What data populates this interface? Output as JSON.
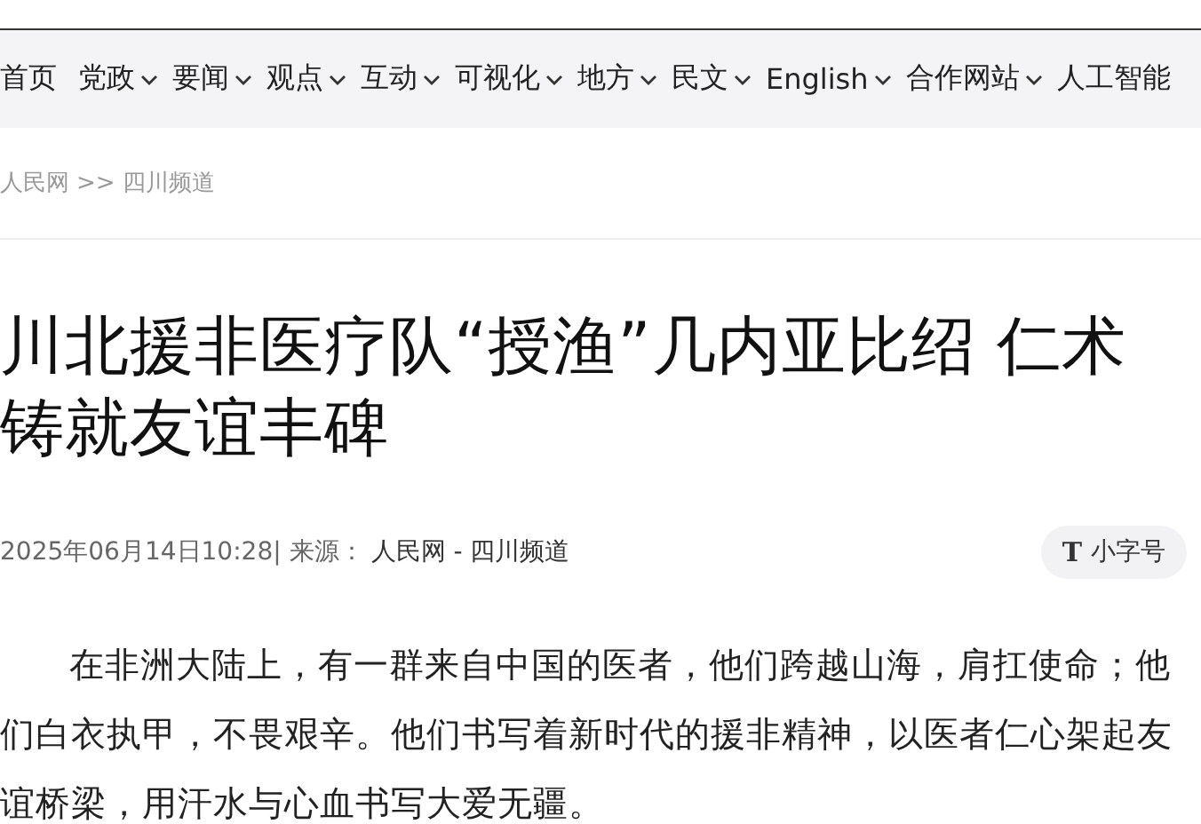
{
  "nav": {
    "items": [
      {
        "label": "首页",
        "dropdown": false
      },
      {
        "label": "党政",
        "dropdown": true
      },
      {
        "label": "要闻",
        "dropdown": true
      },
      {
        "label": "观点",
        "dropdown": true
      },
      {
        "label": "互动",
        "dropdown": true
      },
      {
        "label": "可视化",
        "dropdown": true
      },
      {
        "label": "地方",
        "dropdown": true
      },
      {
        "label": "民文",
        "dropdown": true
      },
      {
        "label": "English",
        "dropdown": true
      },
      {
        "label": "合作网站",
        "dropdown": true
      },
      {
        "label": "人工智能",
        "dropdown": false
      }
    ]
  },
  "breadcrumb": {
    "home": "人民网",
    "separator": ">>",
    "section": "四川频道"
  },
  "article": {
    "title": "川北援非医疗队“授渔”几内亚比绍 仁术铸就友谊丰碑",
    "date": "2025年06月14日10:28",
    "source_label": "| 来源：",
    "source": "人民网 - 四川频道",
    "font_size_button": {
      "icon": "T",
      "label": "小字号"
    },
    "paragraphs": [
      "在非洲大陆上，有一群来自中国的医者，他们跨越山海，肩扛使命；他们白衣执甲，不畏艰辛。他们书写着新时代的援非精神，以医者仁心架起友谊桥梁，用汗水与心血书写大爱无疆。"
    ]
  }
}
